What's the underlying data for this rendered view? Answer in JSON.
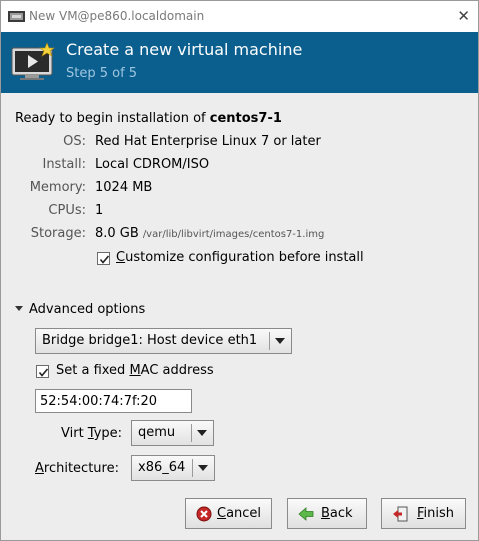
{
  "window": {
    "title": "New VM@pe860.localdomain"
  },
  "banner": {
    "title": "Create a new virtual machine",
    "step": "Step 5 of 5"
  },
  "summary": {
    "ready_prefix": "Ready to begin installation of ",
    "vm_name": "centos7-1",
    "rows": [
      {
        "label": "OS:",
        "value": "Red Hat Enterprise Linux 7 or later"
      },
      {
        "label": "Install:",
        "value": "Local CDROM/ISO"
      },
      {
        "label": "Memory:",
        "value": "1024 MB"
      },
      {
        "label": "CPUs:",
        "value": "1"
      },
      {
        "label": "Storage:",
        "value": "8.0 GB",
        "path": "/var/lib/libvirt/images/centos7-1.img"
      }
    ],
    "customize": {
      "pre": "",
      "mnemonic": "C",
      "post": "ustomize configuration before install",
      "checked": true
    }
  },
  "advanced": {
    "label": "Advanced options",
    "network": "Bridge bridge1: Host device eth1",
    "fixed_mac": {
      "pre": "Set a fixed ",
      "mnemonic": "M",
      "post": "AC address",
      "checked": true
    },
    "mac_value": "52:54:00:74:7f:20",
    "virt_type": {
      "pre": "Virt ",
      "mnemonic": "T",
      "post": "ype:",
      "value": "qemu"
    },
    "architecture": {
      "pre": "",
      "mnemonic": "A",
      "post": "rchitecture:",
      "value": "x86_64"
    }
  },
  "buttons": {
    "cancel": {
      "pre": "",
      "mnemonic": "C",
      "post": "ancel"
    },
    "back": {
      "pre": "",
      "mnemonic": "B",
      "post": "ack"
    },
    "finish": {
      "pre": "",
      "mnemonic": "F",
      "post": "inish"
    }
  },
  "colors": {
    "banner": "#0b5f8f",
    "banner_sub": "#9fc6e0",
    "window_bg": "#ededed"
  }
}
